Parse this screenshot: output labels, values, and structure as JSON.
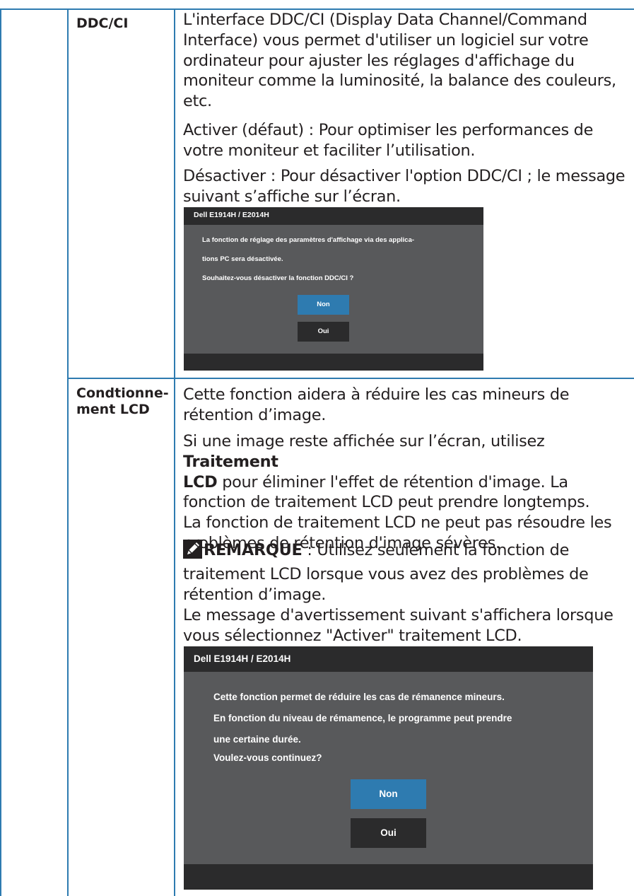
{
  "rows": [
    {
      "label": "DDC/CI",
      "paragraphs": [
        [
          "L'interface DDC/CI (Display Data Channel/Command",
          "Interface) vous permet d'utiliser un logiciel sur votre",
          "ordinateur pour ajuster les réglages d'affichage du",
          "moniteur comme la luminosité, la balance des couleurs,",
          "etc."
        ],
        [
          "Activer (défaut) : Pour optimiser les performances de",
          "votre moniteur et faciliter l’utilisation."
        ],
        [
          "Désactiver : Pour désactiver l'option DDC/CI ; le message",
          "suivant s’affiche sur l’écran."
        ]
      ],
      "dialog": {
        "title": "Dell E1914H / E2014H",
        "lines": [
          "La fonction de réglage des paramètres d'affichage via des applica-",
          "tions PC sera désactivée.",
          "Souhaitez-vous désactiver la fonction DDC/CI ?"
        ],
        "buttons": [
          "Non",
          "Oui"
        ]
      }
    },
    {
      "label_lines": [
        "Condtionne-",
        "ment LCD"
      ],
      "p1": [
        "Cette fonction aidera à réduire les cas mineurs de",
        "rétention d’image."
      ],
      "p2_line1_text": "Si une image reste affichée sur l’écran, utilisez ",
      "p2_line1_bold": "Traitement",
      "p2_line2_bold": "LCD",
      "p2_line2_text": " pour éliminer l'effet de rétention d'image. La",
      "p2_rest": [
        "fonction de traitement LCD peut prendre longtemps.",
        "La fonction de traitement LCD ne peut pas résoudre les",
        "problèmes de rétention d'image sévères."
      ],
      "note_label": "REMARQUE",
      "note_line1": " : Utilisez seulement la fonction de",
      "note_rest": [
        "traitement LCD lorsque vous avez des problèmes de",
        "rétention d’image."
      ],
      "p4": [
        "Le message d'avertissement suivant s'affichera lorsque",
        "vous sélectionnez \"Activer\" traitement LCD."
      ],
      "dialog": {
        "title": "Dell E1914H / E2014H",
        "lines": [
          "Cette fonction permet de réduire les cas de rémanence mineurs.",
          "En fonction du niveau de rémamence, le programme peut prendre",
          "une certaine durée.",
          "Voulez-vous continuez?"
        ],
        "buttons": [
          "Non",
          "Oui"
        ]
      }
    }
  ],
  "colors": {
    "rule": "#2e7bb0",
    "osd_bg": "#58595b",
    "osd_bar": "#2b2b2c",
    "button_primary": "#2e7bb0"
  },
  "icons": {
    "note": "pencil-note-icon"
  }
}
